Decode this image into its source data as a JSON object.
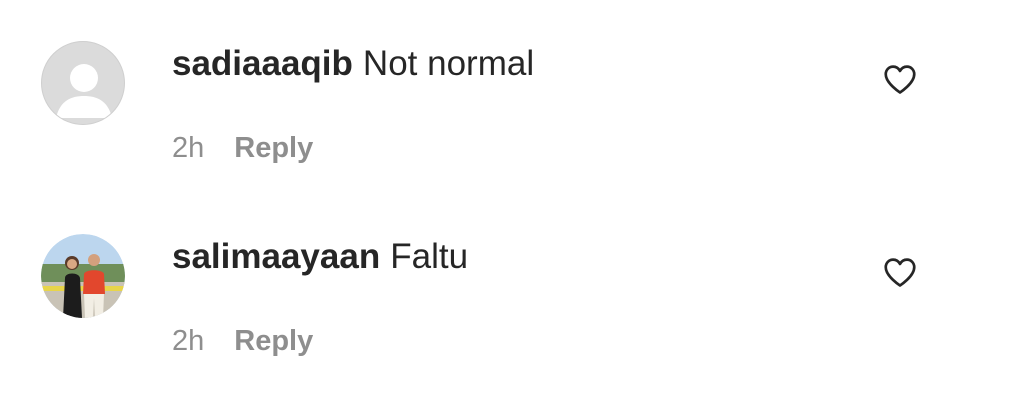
{
  "comments": [
    {
      "username": "sadiaaaqib",
      "text": "Not normal",
      "time": "2h",
      "reply_label": "Reply",
      "avatar": "default-avatar-icon",
      "like_icon": "heart-outline-icon"
    },
    {
      "username": "salimaayaan",
      "text": "Faltu",
      "time": "2h",
      "reply_label": "Reply",
      "avatar": "photo-avatar",
      "like_icon": "heart-outline-icon"
    }
  ],
  "colors": {
    "text": "#262626",
    "secondary": "#8e8e8e",
    "avatar_placeholder": "#dbdbdb"
  }
}
